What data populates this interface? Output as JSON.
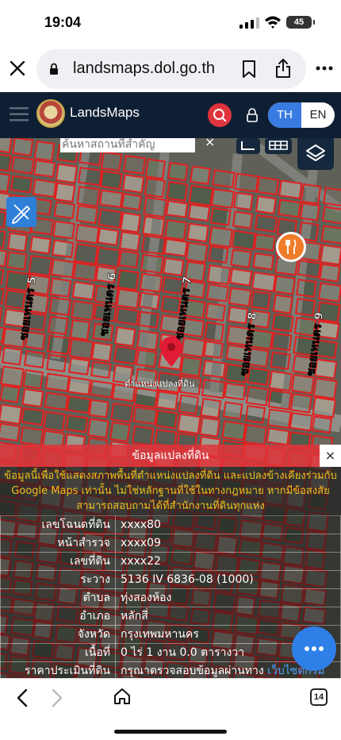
{
  "status_bar": {
    "time": "19:04",
    "battery": "45"
  },
  "browser": {
    "url": "landsmaps.dol.go.th"
  },
  "app": {
    "brand": "LandsMaps",
    "lang_th": "TH",
    "lang_en": "EN",
    "search_placeholder": "ค้นหาสถานที่สำคัญ",
    "search_close": "×"
  },
  "map": {
    "pin_label": "ตำแหน่งแปลงที่ดิน",
    "street_labels": [
      "ซอยเทนตร 5",
      "ซอยเทนตร 6",
      "ซอยเทนตร 7",
      "ซอยเทนตร 8",
      "ซอยเทนตร 9"
    ]
  },
  "panel": {
    "title": "ข้อมูลแปลงที่ดิน",
    "close": "×",
    "note": "ข้อมูลนี้เพื่อใช้แสดงสภาพพื้นที่ตำแหน่งแปลงที่ดิน และแปลงข้างเคียงร่วมกับ Google Maps เท่านั้น ไม่ใช่หลักฐานที่ใช้ในทางกฎหมาย หากมีข้อสงสัยสามารถสอบถามได้ที่สำนักงานที่ดินทุกแห่ง",
    "rows": [
      {
        "label": "เลขโฉนดที่ดิน",
        "value": "xxxx80"
      },
      {
        "label": "หน้าสำรวจ",
        "value": "xxxx09"
      },
      {
        "label": "เลขที่ดิน",
        "value": "xxxx22"
      },
      {
        "label": "ระวาง",
        "value": "5136 IV 6836-08 (1000)"
      },
      {
        "label": "ตำบล",
        "value": "ทุ่งสองห้อง"
      },
      {
        "label": "อำเภอ",
        "value": "หลักสี่"
      },
      {
        "label": "จังหวัด",
        "value": "กรุงเทพมหานคร"
      },
      {
        "label": "เนื้อที่",
        "value": "0 ไร่ 1 งาน 0.0 ตารางวา"
      },
      {
        "label": "ราคาประเมินที่ดิน",
        "value": "กรุณาตรวจสอบข้อมูลผ่านทาง",
        "link": "เว็บไซต์กรม"
      }
    ]
  },
  "nav": {
    "tab_count": "14"
  },
  "colors": {
    "header": "#0f1f33",
    "accent_red": "#e0343d",
    "accent_blue": "#3a7be2",
    "parcel_line": "#e02020"
  }
}
